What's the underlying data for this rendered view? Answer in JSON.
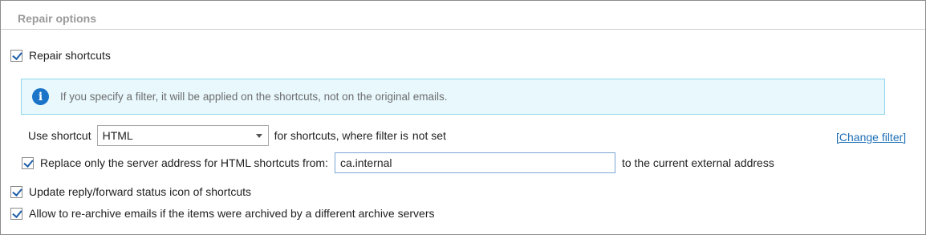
{
  "section": {
    "title": "Repair options"
  },
  "repair_shortcuts": {
    "label": "Repair shortcuts",
    "checked": true
  },
  "info": {
    "icon": "info-icon",
    "text": "If you specify a filter, it will be applied on the shortcuts, not on the original emails."
  },
  "shortcut_row": {
    "prefix": "Use shortcut",
    "select_value": "HTML",
    "middle": "for shortcuts, where filter is",
    "filter_state": "not set",
    "change_filter_link": "[Change filter]"
  },
  "replace_row": {
    "label": "Replace only the server address for HTML shortcuts from:",
    "checked": true,
    "input_value": "ca.internal",
    "suffix": "to the current external address"
  },
  "update_status": {
    "label": "Update reply/forward status icon of shortcuts",
    "checked": true
  },
  "rearchive": {
    "label": "Allow to re-archive emails if the items were archived by a different archive servers",
    "checked": true
  },
  "colors": {
    "accent": "#1f5fa8",
    "info_bg": "#e8f8fd",
    "info_border": "#8fd6ea",
    "link": "#1f6fb5"
  }
}
